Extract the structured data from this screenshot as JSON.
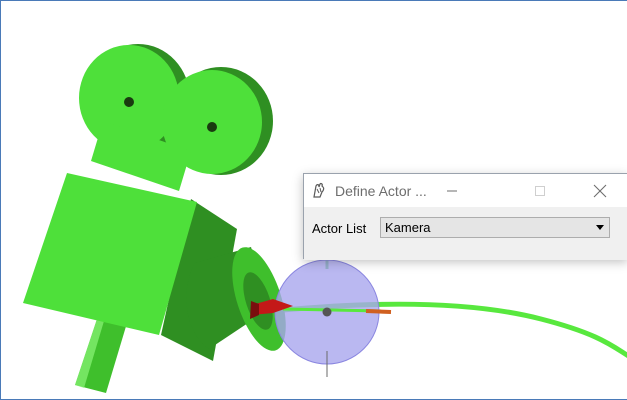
{
  "dialog": {
    "title": "Define Actor ...",
    "actor_list_label": "Actor List",
    "actor_selected": "Kamera",
    "buttons": [
      "minimize-icon",
      "maximize-icon",
      "close-icon"
    ]
  },
  "scene": {
    "object": "camera-model",
    "gizmo": "translate-sphere-gizmo",
    "colors": {
      "camera_green": "#4ee03a",
      "camera_dark_green": "#2f8f22",
      "path_green": "#58e83e",
      "gizmo_blue": "#a9a6ee",
      "arrow_red": "#c41818",
      "axis_orange": "#d06020",
      "frame_blue": "#4a7ab8"
    }
  }
}
